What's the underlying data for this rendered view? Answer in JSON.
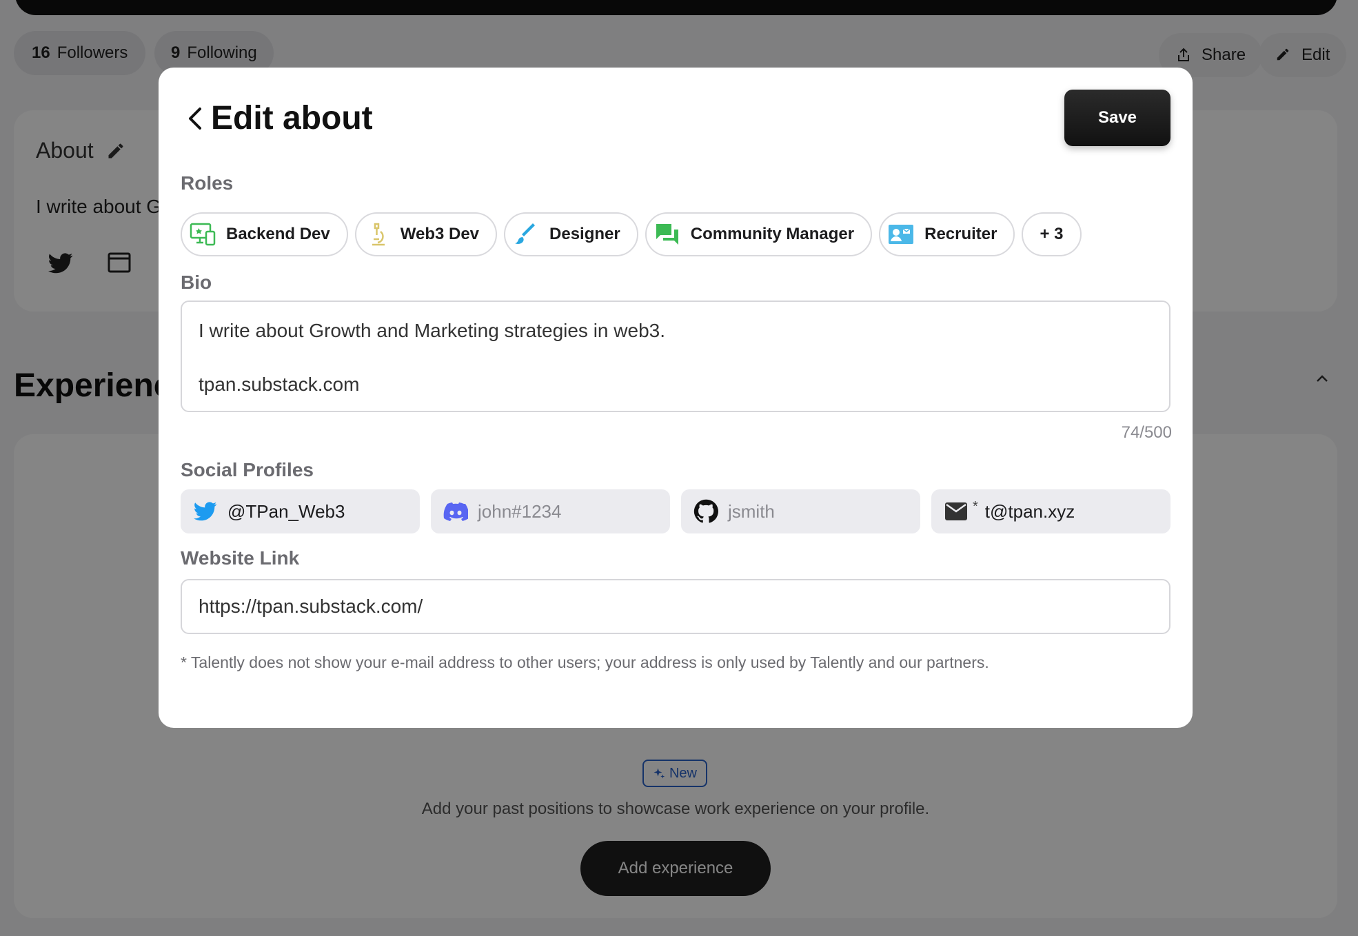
{
  "profile": {
    "followers_count": "16",
    "followers_label": "Followers",
    "following_count": "9",
    "following_label": "Following",
    "share_label": "Share",
    "edit_label": "Edit"
  },
  "about": {
    "title": "About",
    "text_visible": "I write about G"
  },
  "experience": {
    "title": "Experienc",
    "new_badge": "New",
    "description": "Add your past positions to showcase work experience on your profile.",
    "add_button": "Add experience"
  },
  "modal": {
    "title": "Edit about",
    "save_label": "Save",
    "roles_label": "Roles",
    "roles": [
      {
        "label": "Backend Dev",
        "icon": "monitor-devices-icon"
      },
      {
        "label": "Web3 Dev",
        "icon": "microscope-icon"
      },
      {
        "label": "Designer",
        "icon": "brush-icon"
      },
      {
        "label": "Community Manager",
        "icon": "chat-bubbles-icon"
      },
      {
        "label": "Recruiter",
        "icon": "contact-card-icon"
      }
    ],
    "roles_more": "+ 3",
    "bio_label": "Bio",
    "bio_line1": "I write about Growth and Marketing strategies in web3.",
    "bio_line2": "tpan.substack.com",
    "bio_counter": "74/500",
    "social_label": "Social Profiles",
    "socials": {
      "twitter_value": "@TPan_Web3",
      "discord_placeholder": "john#1234",
      "github_placeholder": "jsmith",
      "email_star": "*",
      "email_value": "t@tpan.xyz"
    },
    "website_label": "Website Link",
    "website_value": "https://tpan.substack.com/",
    "footnote": "* Talently does not show your e-mail address to other users; your address is only used by Talently and our partners."
  },
  "colors": {
    "twitter": "#1d9bf0",
    "discord": "#5865f2",
    "green": "#3cba54",
    "badge_blue": "#2a62c9"
  }
}
